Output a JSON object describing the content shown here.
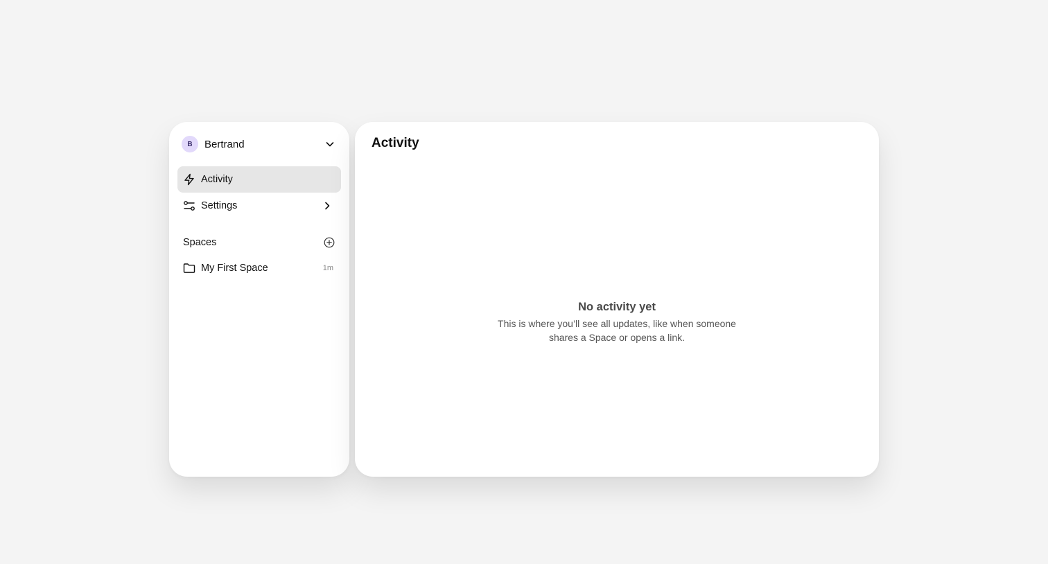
{
  "user": {
    "initial": "B",
    "name": "Bertrand"
  },
  "nav": {
    "items": [
      {
        "label": "Activity",
        "icon": "bolt-icon",
        "active": true
      },
      {
        "label": "Settings",
        "icon": "sliders-icon",
        "active": false
      }
    ]
  },
  "spaces": {
    "title": "Spaces",
    "items": [
      {
        "name": "My First Space",
        "time": "1m",
        "icon": "folder-icon"
      }
    ]
  },
  "main": {
    "title": "Activity",
    "empty_title": "No activity yet",
    "empty_description": "This is where you’ll see all updates, like when someone shares a Space or opens a link."
  },
  "colors": {
    "background": "#f4f4f4",
    "panel": "#ffffff",
    "active_item": "#e6e6e6",
    "avatar": "#e2d9fb"
  }
}
